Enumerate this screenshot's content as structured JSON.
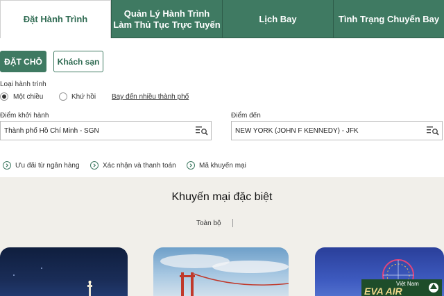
{
  "tabs": [
    {
      "label": "Đặt Hành Trình",
      "active": true
    },
    {
      "label_line1": "Quản Lý Hành Trình",
      "label_line2": "Làm Thủ Tục Trực Tuyến"
    },
    {
      "label": "Lịch Bay"
    },
    {
      "label": "Tình Trạng Chuyến Bay"
    }
  ],
  "booking": {
    "book_button": "ĐẶT CHỖ",
    "hotel_button": "Khách sạn",
    "trip_type_label": "Loại hành trình",
    "one_way": "Một chiều",
    "round_trip": "Khứ hồi",
    "multi_city_link": "Bay đến nhiều thành phố",
    "origin_label": "Điểm khởi hành",
    "origin_value": "Thành phố Hồ Chí Minh - SGN",
    "destination_label": "Điểm đến",
    "destination_value": "NEW YORK (JOHN F KENNEDY) - JFK"
  },
  "quick_links": [
    {
      "label": "Ưu đãi từ ngân hàng"
    },
    {
      "label": "Xác nhận và thanh toán"
    },
    {
      "label": "Mã khuyến mại"
    }
  ],
  "promo": {
    "title": "Khuyến mại đặc biệt",
    "filter_all": "Toàn bộ"
  },
  "logo": {
    "top_text": "Việt Nam",
    "brand_text": "EVA AIR"
  },
  "colors": {
    "brand_green": "#3f7a62",
    "promo_background": "#f1efea"
  }
}
